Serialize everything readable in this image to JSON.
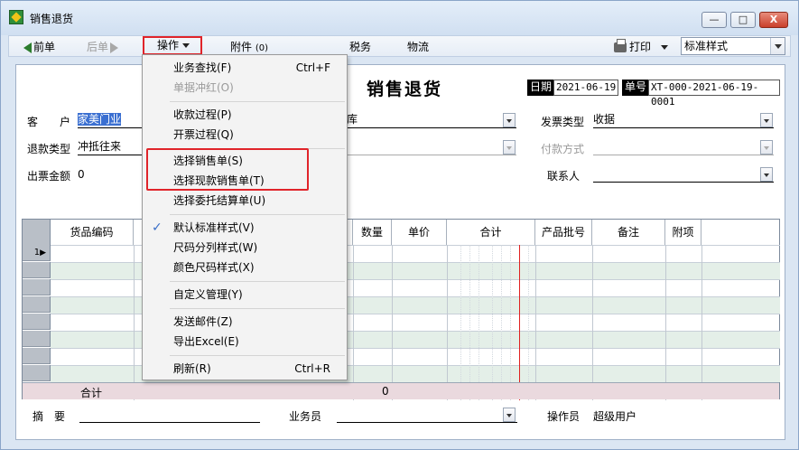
{
  "window": {
    "title": "销售退货",
    "min_label": "—",
    "max_label": "□",
    "close_label": "X"
  },
  "toolbar": {
    "prev_label": "前单",
    "next_label": "后单",
    "ops_label": "操作",
    "attach_label": "附件",
    "attach_count": "(0)",
    "tax_label": "税务",
    "logistics_label": "物流",
    "print_label": "打印",
    "print_style": "标准样式"
  },
  "form": {
    "title": "销售退货",
    "date_label": "日期",
    "date_value": "2021-06-19",
    "no_label": "单号",
    "no_value": "XT-000-2021-06-19-0001",
    "customer_label": "客　　户",
    "customer_value": "家美门业",
    "warehouse_partial": "库",
    "invoice_type_label": "发票类型",
    "invoice_type_value": "收据",
    "refund_type_label": "退款类型",
    "refund_type_value": "冲抵往来",
    "pay_method_label": "付款方式",
    "invoice_amount_label": "出票金额",
    "invoice_amount_value": "0",
    "contact_label": "联系人",
    "summary_label": "摘　要",
    "salesman_label": "业务员",
    "operator_label": "操作员",
    "operator_value": "超级用户"
  },
  "grid": {
    "columns": [
      "货品编码",
      "数量",
      "单价",
      "合计",
      "产品批号",
      "备注",
      "附项"
    ],
    "first_row_marker": "1",
    "total_label": "合计",
    "total_qty": "0"
  },
  "menu": {
    "items": [
      {
        "label": "业务查找(F)",
        "shortcut": "Ctrl+F"
      },
      {
        "label": "单据冲红(O)"
      },
      {
        "label": "收款过程(P)"
      },
      {
        "label": "开票过程(Q)"
      },
      {
        "label": "选择销售单(S)"
      },
      {
        "label": "选择现款销售单(T)"
      },
      {
        "label": "选择委托结算单(U)"
      },
      {
        "label": "默认标准样式(V)"
      },
      {
        "label": "尺码分列样式(W)"
      },
      {
        "label": "颜色尺码样式(X)"
      },
      {
        "label": "自定义管理(Y)"
      },
      {
        "label": "发送邮件(Z)"
      },
      {
        "label": "导出Excel(E)"
      },
      {
        "label": "刷新(R)",
        "shortcut": "Ctrl+R"
      }
    ],
    "check_glyph": "✓"
  },
  "colors": {
    "accent_red": "#e0242a",
    "selection_blue": "#3a6fd1",
    "row_alt": "#e4efe8",
    "total_row": "#ead9de"
  }
}
